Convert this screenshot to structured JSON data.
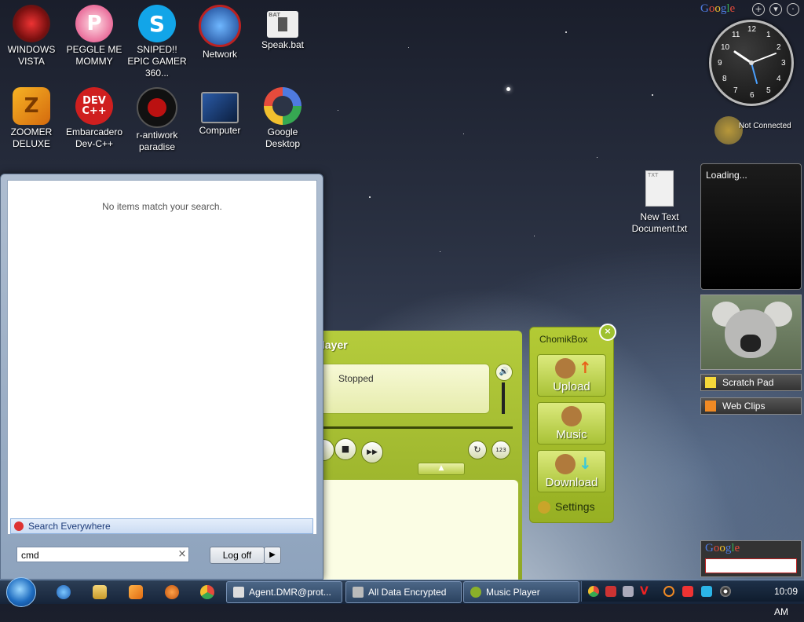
{
  "desktop": {
    "icons": [
      {
        "label": "WINDOWS VISTA",
        "icon": "vista-orb-icon"
      },
      {
        "label": "PEGGLE ME MOMMY",
        "icon": "peggle-icon"
      },
      {
        "label": "SNIPED!! EPIC GAMER 360...",
        "icon": "skype-icon"
      },
      {
        "label": "Network",
        "icon": "network-icon"
      },
      {
        "label": "Speak.bat",
        "icon": "bat-file-icon"
      },
      {
        "label": "ZOOMER DELUXE",
        "icon": "zoomer-icon"
      },
      {
        "label": "Embarcadero Dev-C++",
        "icon": "devcpp-icon"
      },
      {
        "label": "r-antiwork paradise",
        "icon": "antiwork-icon"
      },
      {
        "label": "Computer",
        "icon": "computer-icon"
      },
      {
        "label": "Google Desktop",
        "icon": "google-desktop-icon"
      }
    ],
    "new_doc": {
      "label": "New Text Document.txt",
      "badge": "TXT"
    },
    "speak_badge": "BAT"
  },
  "start_menu": {
    "empty_message": "No items match your search.",
    "search_everywhere": "Search Everywhere",
    "search_value": "cmd",
    "clear_glyph": "×",
    "logoff_label": "Log off",
    "logoff_arrow": "▶"
  },
  "music_player": {
    "title": "layer",
    "status": "Stopped",
    "buttons": {
      "stop": "■",
      "forward": "▶▶",
      "repeat": "↻",
      "number": "123",
      "expand": "▲",
      "volume": "🔊"
    }
  },
  "chomikbox": {
    "title": "ChomikBox",
    "close": "×",
    "upload": "Upload",
    "music": "Music",
    "download": "Download",
    "settings": "Settings"
  },
  "gadgets": {
    "google_logo": [
      "G",
      "o",
      "o",
      "g",
      "l",
      "e"
    ],
    "clock_numbers": [
      "12",
      "1",
      "2",
      "3",
      "4",
      "5",
      "6",
      "7",
      "8",
      "9",
      "10",
      "11"
    ],
    "weather_status": "Not Connected",
    "loading_text": "Loading...",
    "scratch_pad": "Scratch Pad",
    "web_clips": "Web Clips",
    "header_add": "+",
    "header_menu": "▾",
    "header_close": "·"
  },
  "taskbar": {
    "windows": [
      {
        "label": "Agent.DMR@prot...",
        "icon": "messenger-icon"
      },
      {
        "label": "All Data Encrypted",
        "icon": "window-icon"
      },
      {
        "label": "Music Player",
        "icon": "music-player-icon"
      }
    ],
    "time": "10:09 AM"
  },
  "colors": {
    "player_green": "#a4bf30",
    "taskbar": "#1f3048",
    "accent_blue": "#3b7bd8"
  }
}
